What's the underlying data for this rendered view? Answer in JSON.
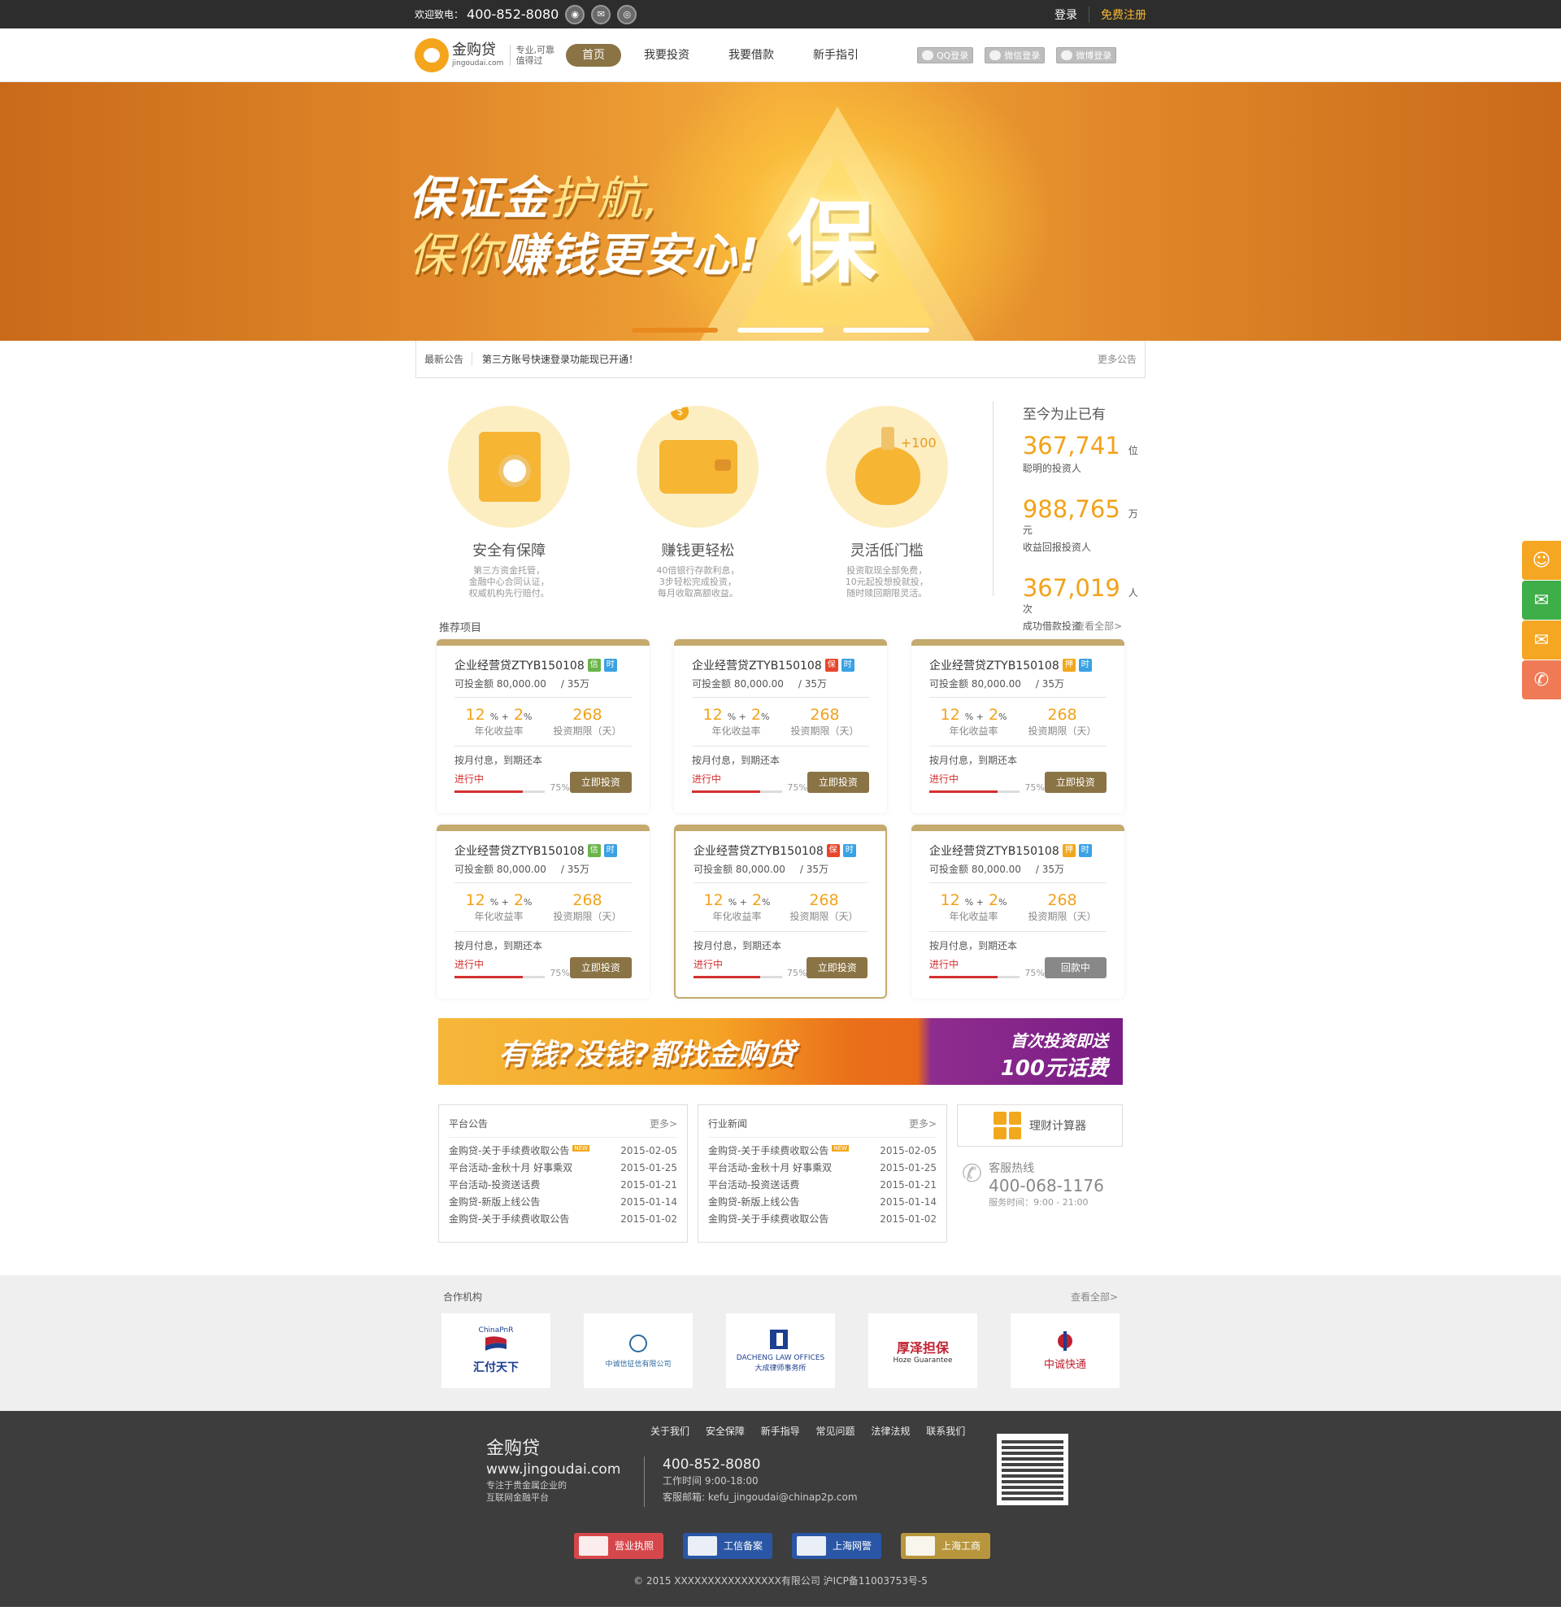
{
  "topbar": {
    "welcome": "欢迎致电：",
    "phone": "400-852-8080",
    "login": "登录",
    "register": "免费注册"
  },
  "header": {
    "logo_cn": "金购贷",
    "logo_en": "jingoudai.com",
    "slogan1": "专业,可靠",
    "slogan2": "值得过",
    "nav": [
      "首页",
      "我要投资",
      "我要借款",
      "新手指引"
    ],
    "oauth": [
      "QQ登录",
      "微信登录",
      "微博登录"
    ]
  },
  "banner": {
    "line1a": "保证金",
    "line1b": "护航,",
    "line2a": "保你",
    "line2b": "赚钱更安心!",
    "bao": "保"
  },
  "notice": {
    "label": "最新公告",
    "message": "第三方账号快速登录功能现已开通！",
    "more": "更多公告"
  },
  "features": [
    {
      "title": "安全有保障",
      "desc1": "第三方资金托管，",
      "desc2": "金融中心合同认证，",
      "desc3": "权威机构先行赔付。"
    },
    {
      "title": "赚钱更轻松",
      "desc1": "40倍银行存款利息，",
      "desc2": "3步轻松完成投资，",
      "desc3": "每月收取高额收益。"
    },
    {
      "title": "灵活低门槛",
      "desc1": "投资取现全部免费，",
      "desc2": "10元起投想投就投，",
      "desc3": "随时赎回期限灵活。"
    }
  ],
  "feature_plus": "+100",
  "stats": {
    "title": "至今为止已有",
    "items": [
      {
        "num": "367,741",
        "unit": "位",
        "label": "聪明的投资人"
      },
      {
        "num": "988,765",
        "unit": "万元",
        "label": "收益回报投资人"
      },
      {
        "num": "367,019",
        "unit": "人次",
        "label": "成功借款投资"
      }
    ]
  },
  "products_section": {
    "title": "推荐项目",
    "more": "查看全部>"
  },
  "products": [
    {
      "name": "企业经营贷ZTYB150108",
      "tag1": "信",
      "tag2": "时",
      "amount_label": "可投金额",
      "amount": "80,000.00",
      "total": "/ 35万",
      "rate": "12",
      "rate_plus": "2",
      "rate_label": "年化收益率",
      "days": "268",
      "days_label": "投资期限（天）",
      "pay": "按月付息，到期还本",
      "status": "进行中",
      "progress": 0.75,
      "pct": "75%",
      "button": "立即投资"
    },
    {
      "name": "企业经营贷ZTYB150108",
      "tag1": "保",
      "tag2": "时",
      "amount_label": "可投金额",
      "amount": "80,000.00",
      "total": "/ 35万",
      "rate": "12",
      "rate_plus": "2",
      "rate_label": "年化收益率",
      "days": "268",
      "days_label": "投资期限（天）",
      "pay": "按月付息，到期还本",
      "status": "进行中",
      "progress": 0.75,
      "pct": "75%",
      "button": "立即投资"
    },
    {
      "name": "企业经营贷ZTYB150108",
      "tag1": "押",
      "tag2": "时",
      "amount_label": "可投金额",
      "amount": "80,000.00",
      "total": "/ 35万",
      "rate": "12",
      "rate_plus": "2",
      "rate_label": "年化收益率",
      "days": "268",
      "days_label": "投资期限（天）",
      "pay": "按月付息，到期还本",
      "status": "进行中",
      "progress": 0.75,
      "pct": "75%",
      "button": "立即投资"
    },
    {
      "name": "企业经营贷ZTYB150108",
      "tag1": "信",
      "tag2": "时",
      "amount_label": "可投金额",
      "amount": "80,000.00",
      "total": "/ 35万",
      "rate": "12",
      "rate_plus": "2",
      "rate_label": "年化收益率",
      "days": "268",
      "days_label": "投资期限（天）",
      "pay": "按月付息，到期还本",
      "status": "进行中",
      "progress": 0.75,
      "pct": "75%",
      "button": "立即投资"
    },
    {
      "name": "企业经营贷ZTYB150108",
      "tag1": "保",
      "tag2": "时",
      "amount_label": "可投金额",
      "amount": "80,000.00",
      "total": "/ 35万",
      "rate": "12",
      "rate_plus": "2",
      "rate_label": "年化收益率",
      "days": "268",
      "days_label": "投资期限（天）",
      "pay": "按月付息，到期还本",
      "status": "进行中",
      "progress": 0.75,
      "pct": "75%",
      "button": "立即投资"
    },
    {
      "name": "企业经营贷ZTYB150108",
      "tag1": "押",
      "tag2": "时",
      "amount_label": "可投金额",
      "amount": "80,000.00",
      "total": "/ 35万",
      "rate": "12",
      "rate_plus": "2",
      "rate_label": "年化收益率",
      "days": "268",
      "days_label": "投资期限（天）",
      "pay": "按月付息，到期还本",
      "status": "进行中",
      "progress": 0.75,
      "pct": "75%",
      "button": "回款中"
    }
  ],
  "promo": {
    "main": "有钱?没钱?都找金购贷",
    "side1": "首次投资即送",
    "side2": "100元话费"
  },
  "platform_news": {
    "title": "平台公告",
    "more": "更多>",
    "items": [
      {
        "t": "金购贷-关于手续费收取公告",
        "d": "2015-02-05",
        "new": "NEW"
      },
      {
        "t": "平台活动-金秋十月 好事乘双",
        "d": "2015-01-25"
      },
      {
        "t": "平台活动-投资送话费",
        "d": "2015-01-21"
      },
      {
        "t": "金购贷-新版上线公告",
        "d": "2015-01-14"
      },
      {
        "t": "金购贷-关于手续费收取公告",
        "d": "2015-01-02"
      }
    ]
  },
  "industry_news": {
    "title": "行业新闻",
    "more": "更多>",
    "items": [
      {
        "t": "金购贷-关于手续费收取公告",
        "d": "2015-02-05",
        "new": "NEW"
      },
      {
        "t": "平台活动-金秋十月 好事乘双",
        "d": "2015-01-25"
      },
      {
        "t": "平台活动-投资送话费",
        "d": "2015-01-21"
      },
      {
        "t": "金购贷-新版上线公告",
        "d": "2015-01-14"
      },
      {
        "t": "金购贷-关于手续费收取公告",
        "d": "2015-01-02"
      }
    ]
  },
  "calc": {
    "label": "理财计算器"
  },
  "hotline": {
    "title": "客服热线",
    "phone": "400-068-1176",
    "hours": "服务时间：9:00 - 21:00"
  },
  "partners": {
    "title": "合作机构",
    "more": "查看全部>",
    "p1": "汇付天下",
    "p1s": "ChinaPnR",
    "p2": "中诚信征信有限公司",
    "p3": "DACHENG LAW OFFICES",
    "p3s": "大成律师事务所",
    "p4": "厚泽担保",
    "p4s": "Hoze Guarantee",
    "p5": "中诚快通"
  },
  "footer": {
    "links": [
      "关于我们",
      "安全保障",
      "新手指导",
      "常见问题",
      "法律法规",
      "联系我们"
    ],
    "brand": "金购贷",
    "site": "www.jingoudai.com",
    "desc1": "专注于贵金属企业的",
    "desc2": "互联网金融平台",
    "phone": "400-852-8080",
    "worktime": "工作时间 9:00-18:00",
    "email": "客服邮箱: kefu_jingoudai@chinap2p.com",
    "certs": [
      "营业执照",
      "工信备案",
      "上海网警",
      "上海工商"
    ],
    "copyright": "© 2015 XXXXXXXXXXXXXXXX有限公司 沪ICP备11003753号-5"
  },
  "colors": {
    "accent": "#f2a21a",
    "brand": "#8a7344",
    "banner": "#e28a2a",
    "progress": "#d43030"
  }
}
